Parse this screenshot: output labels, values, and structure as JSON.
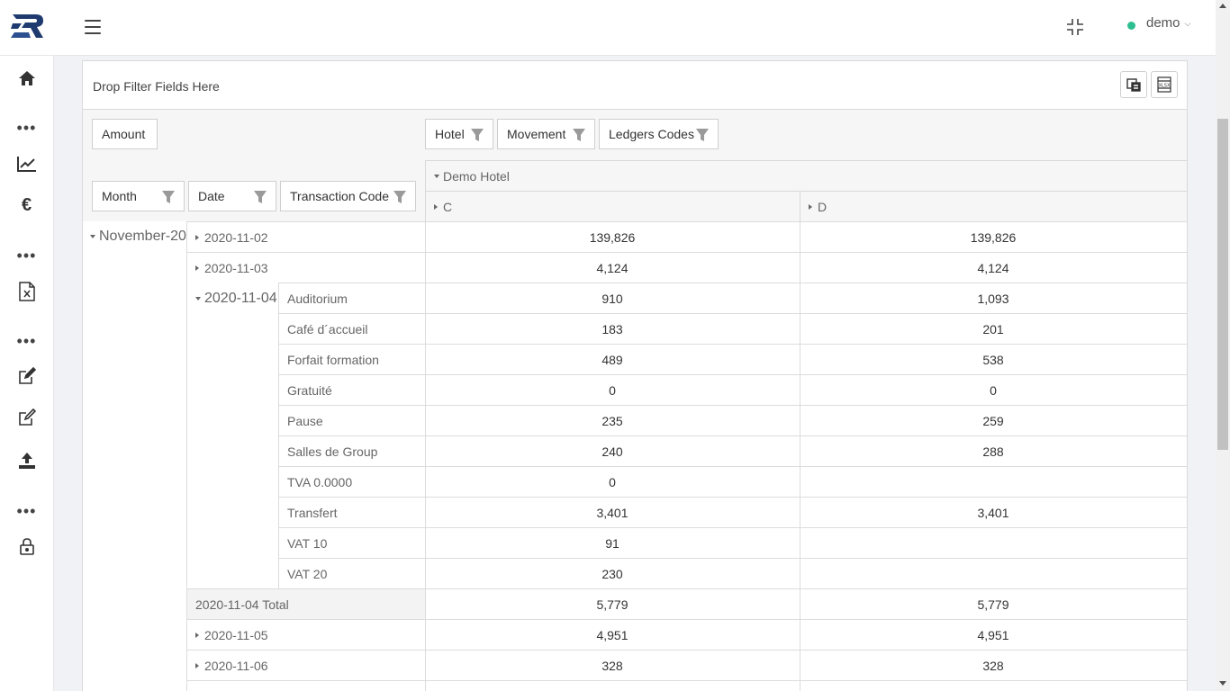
{
  "user": {
    "name": "demo"
  },
  "pivot": {
    "filter_drop_text": "Drop Filter Fields Here",
    "measure": "Amount",
    "column_fields": [
      "Hotel",
      "Movement",
      "Ledgers Codes"
    ],
    "row_fields": [
      "Month",
      "Date",
      "Transaction Code"
    ],
    "hotel_header": "Demo Hotel",
    "movement_headers": [
      "C",
      "D"
    ],
    "month": "November-20",
    "rows": [
      {
        "date": "2020-11-02",
        "c": "139,826",
        "d": "139,826"
      },
      {
        "date": "2020-11-03",
        "c": "4,124",
        "d": "4,124"
      }
    ],
    "expanded_date": "2020-11-04",
    "transactions": [
      {
        "code": "Auditorium",
        "c": "910",
        "d": "1,093"
      },
      {
        "code": "Café d´accueil",
        "c": "183",
        "d": "201"
      },
      {
        "code": "Forfait formation",
        "c": "489",
        "d": "538"
      },
      {
        "code": "Gratuité",
        "c": "0",
        "d": "0"
      },
      {
        "code": "Pause",
        "c": "235",
        "d": "259"
      },
      {
        "code": "Salles de Group",
        "c": "240",
        "d": "288"
      },
      {
        "code": "TVA 0.0000",
        "c": "0",
        "d": ""
      },
      {
        "code": "Transfert",
        "c": "3,401",
        "d": "3,401"
      },
      {
        "code": "VAT 10",
        "c": "91",
        "d": ""
      },
      {
        "code": "VAT 20",
        "c": "230",
        "d": ""
      }
    ],
    "total": {
      "label": "2020-11-04 Total",
      "c": "5,779",
      "d": "5,779"
    },
    "rows_after": [
      {
        "date": "2020-11-05",
        "c": "4,951",
        "d": "4,951"
      },
      {
        "date": "2020-11-06",
        "c": "328",
        "d": "328"
      }
    ]
  }
}
